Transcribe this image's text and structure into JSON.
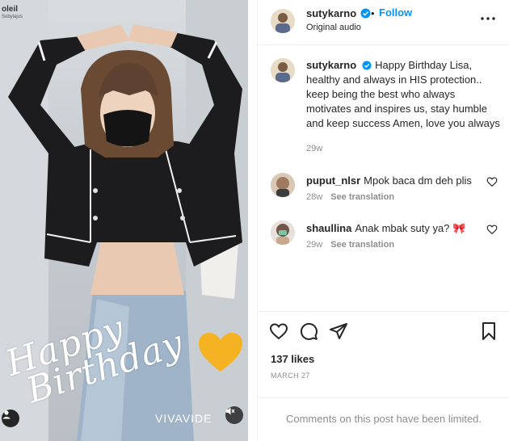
{
  "media": {
    "brand_top_left": "oleil",
    "brand_top_left_sub": "Sobylajus",
    "overlay_text_line1": "Happy",
    "overlay_text_line2": "Birthday",
    "watermark": "VIVAVIDE",
    "heart_color": "#f5b324"
  },
  "header": {
    "username": "sutykarno",
    "follow_label": "Follow",
    "separator": "•",
    "audio_label": "Original audio",
    "more_icon": "more-horizontal-icon"
  },
  "caption": {
    "username": "sutykarno",
    "text": "Happy Birthday Lisa, healthy and always in HIS protection.. keep being the best who always motivates and inspires us, stay humble and keep success Amen, love you always",
    "time": "29w"
  },
  "comments": [
    {
      "username": "puput_nlsr",
      "text": "Mpok baca dm deh plis",
      "time": "28w",
      "see_translation": "See translation"
    },
    {
      "username": "shaullina",
      "text": "Anak mbak suty ya? 🎀",
      "time": "29w",
      "see_translation": "See translation"
    }
  ],
  "actions": {
    "likes": "137 likes",
    "date": "MARCH 27"
  },
  "footer": {
    "limited_text": "Comments on this post have been limited."
  },
  "colors": {
    "accent": "#0095f6",
    "text": "#262626",
    "muted": "#8e8e8e",
    "border": "#efefef"
  }
}
